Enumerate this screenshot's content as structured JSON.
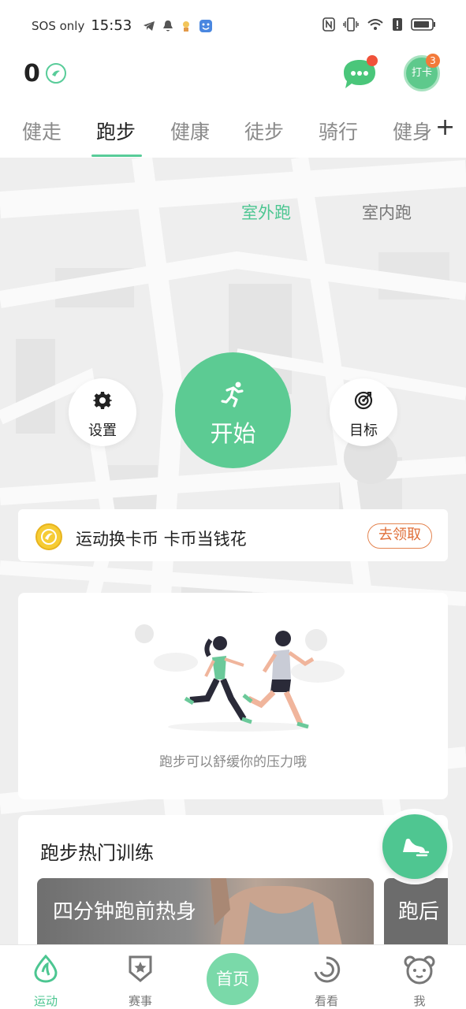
{
  "status_bar": {
    "carrier": "SOS only",
    "time": "15:53"
  },
  "header": {
    "coin_count": "0",
    "checkin_label": "打卡",
    "checkin_badge": "3"
  },
  "tabs": [
    {
      "label": "健走"
    },
    {
      "label": "跑步"
    },
    {
      "label": "健康"
    },
    {
      "label": "徒步"
    },
    {
      "label": "骑行"
    },
    {
      "label": "健身"
    }
  ],
  "tab_more": "+",
  "run_mode": {
    "outdoor": "室外跑",
    "indoor": "室内跑",
    "selected": "室外跑"
  },
  "controls": {
    "settings_label": "设置",
    "start_label": "开始",
    "goal_label": "目标"
  },
  "promo": {
    "text": "运动换卡币 卡币当钱花",
    "button": "去领取"
  },
  "illustration": {
    "caption": "跑步可以舒缓你的压力哦"
  },
  "training": {
    "title": "跑步热门训练",
    "items": [
      {
        "title": "四分钟跑前热身"
      },
      {
        "title": "跑后"
      }
    ]
  },
  "bottom_nav": {
    "items": [
      {
        "label": "运动"
      },
      {
        "label": "赛事"
      },
      {
        "label": "看看"
      },
      {
        "label": "我"
      }
    ],
    "home_label": "首页",
    "active": "运动"
  },
  "colors": {
    "accent": "#58cc99",
    "orange": "#e48450",
    "badge_red": "#f0523a"
  }
}
